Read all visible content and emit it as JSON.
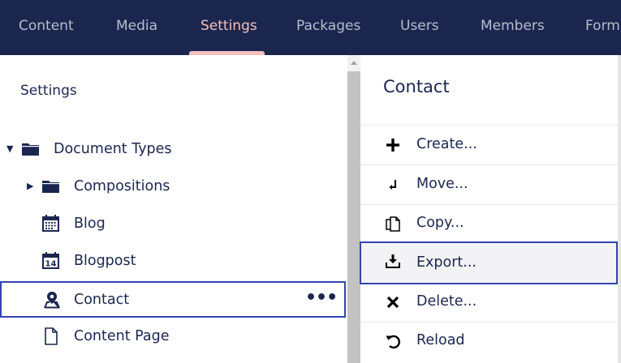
{
  "nav": {
    "items": [
      {
        "label": "Content",
        "active": false
      },
      {
        "label": "Media",
        "active": false
      },
      {
        "label": "Settings",
        "active": true
      },
      {
        "label": "Packages",
        "active": false
      },
      {
        "label": "Users",
        "active": false
      },
      {
        "label": "Members",
        "active": false
      },
      {
        "label": "Form",
        "active": false
      }
    ]
  },
  "tree": {
    "heading": "Settings",
    "items": [
      {
        "label": "Document Types",
        "icon": "folder-icon",
        "expanded": true
      },
      {
        "label": "Compositions",
        "icon": "folder-icon",
        "expanded": false
      },
      {
        "label": "Blog",
        "icon": "calendar-icon"
      },
      {
        "label": "Blogpost",
        "icon": "calendar-14-icon"
      },
      {
        "label": "Contact",
        "icon": "map-pin-icon",
        "selected": true,
        "actions": "•••"
      },
      {
        "label": "Content Page",
        "icon": "document-icon"
      }
    ]
  },
  "menu": {
    "title": "Contact",
    "items": [
      {
        "label": "Create...",
        "icon": "plus-icon"
      },
      {
        "label": "Move...",
        "icon": "move-icon"
      },
      {
        "label": "Copy...",
        "icon": "copy-icon"
      },
      {
        "label": "Export...",
        "icon": "export-icon",
        "highlighted": true
      },
      {
        "label": "Delete...",
        "icon": "close-icon"
      },
      {
        "label": "Reload",
        "icon": "reload-icon"
      }
    ]
  },
  "colors": {
    "header_bg": "#1b264f",
    "nav_text": "#b8bccb",
    "nav_active": "#f5c1bc",
    "text": "#1b264f",
    "focus_border": "#3544b1"
  }
}
